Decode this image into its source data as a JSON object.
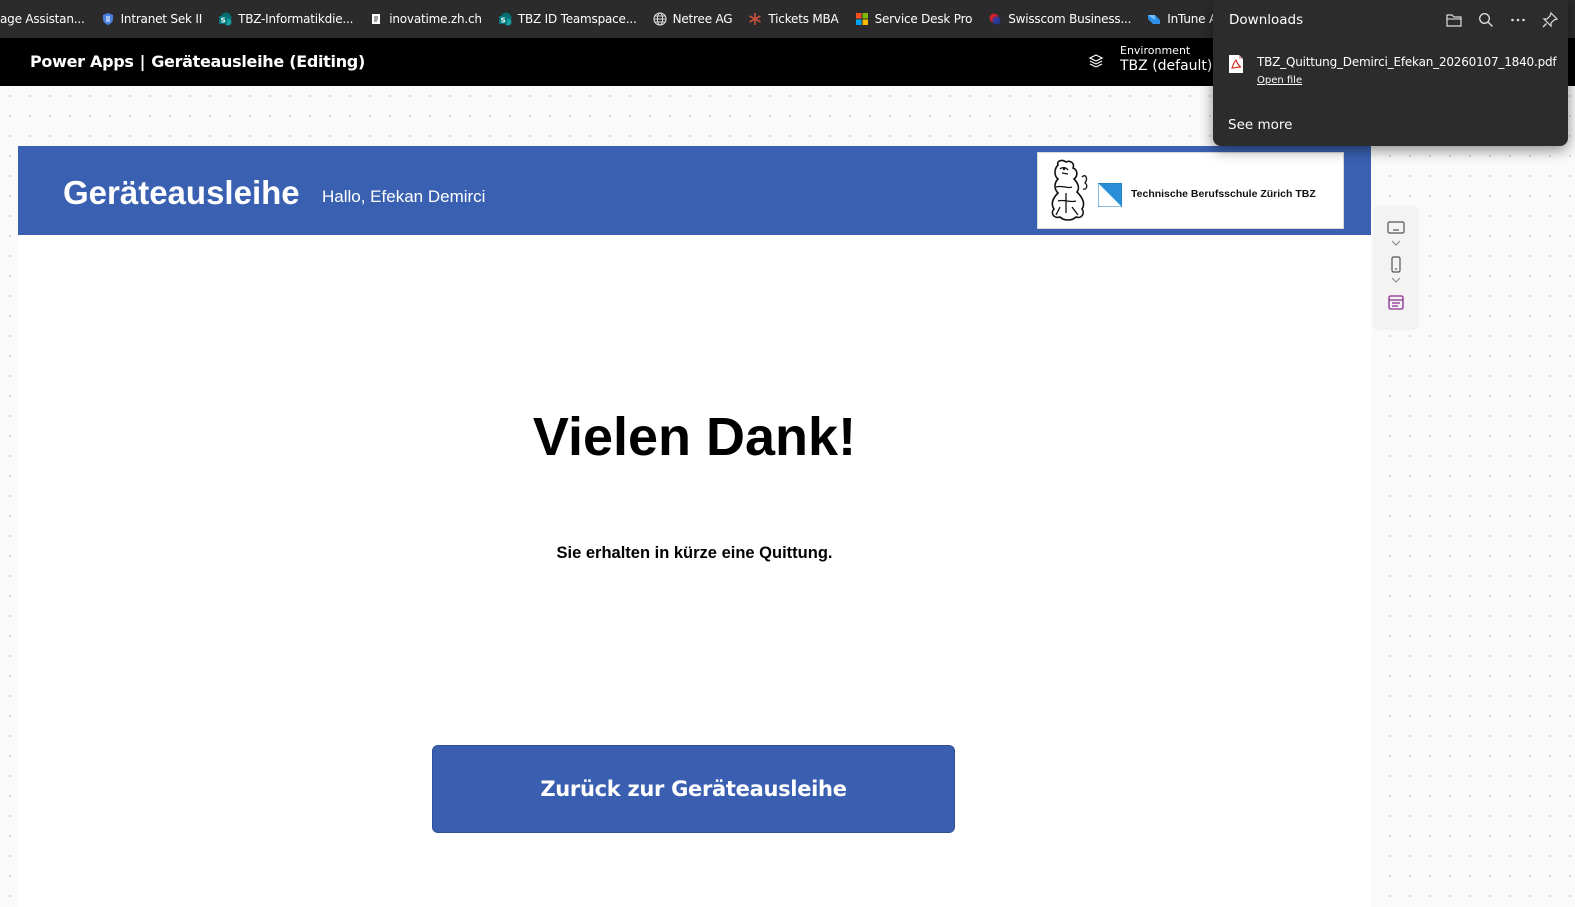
{
  "bookmarks": [
    {
      "label": "age Assistan...",
      "icon": "none"
    },
    {
      "label": "Intranet Sek II",
      "icon": "shield-icon"
    },
    {
      "label": "TBZ-Informatikdie...",
      "icon": "sharepoint-icon"
    },
    {
      "label": "inovatime.zh.ch",
      "icon": "page-icon"
    },
    {
      "label": "TBZ ID Teamspace...",
      "icon": "sharepoint-icon"
    },
    {
      "label": "Netree AG",
      "icon": "globe-icon"
    },
    {
      "label": "Tickets MBA",
      "icon": "asterisk-icon"
    },
    {
      "label": "Service Desk Pro",
      "icon": "windows-icon"
    },
    {
      "label": "Swisscom Business...",
      "icon": "swisscom-icon"
    },
    {
      "label": "InTune A",
      "icon": "intune-icon"
    }
  ],
  "header": {
    "product": "Power Apps",
    "separator": "|",
    "app_name": "Geräteausleihe (Editing)",
    "environment_label": "Environment",
    "environment_value": "TBZ (default)"
  },
  "downloads": {
    "title": "Downloads",
    "file_name": "TBZ_Quittung_Demirci_Efekan_20260107_1840.pdf",
    "open_file": "Open file",
    "see_more": "See more"
  },
  "app": {
    "title": "Geräteausleihe",
    "greeting": "Hallo, Efekan Demirci",
    "logo_text": "Technische Berufsschule Zürich TBZ",
    "thanks_title": "Vielen Dank!",
    "thanks_subtitle": "Sie erhalten in kürze eine Quittung.",
    "back_button": "Zurück zur Geräteausleihe"
  },
  "colors": {
    "brand_blue": "#3a61b1",
    "header_black": "#000000",
    "bookmarks_bg": "#2b2b2b",
    "downloads_bg": "#2c2c2c"
  }
}
